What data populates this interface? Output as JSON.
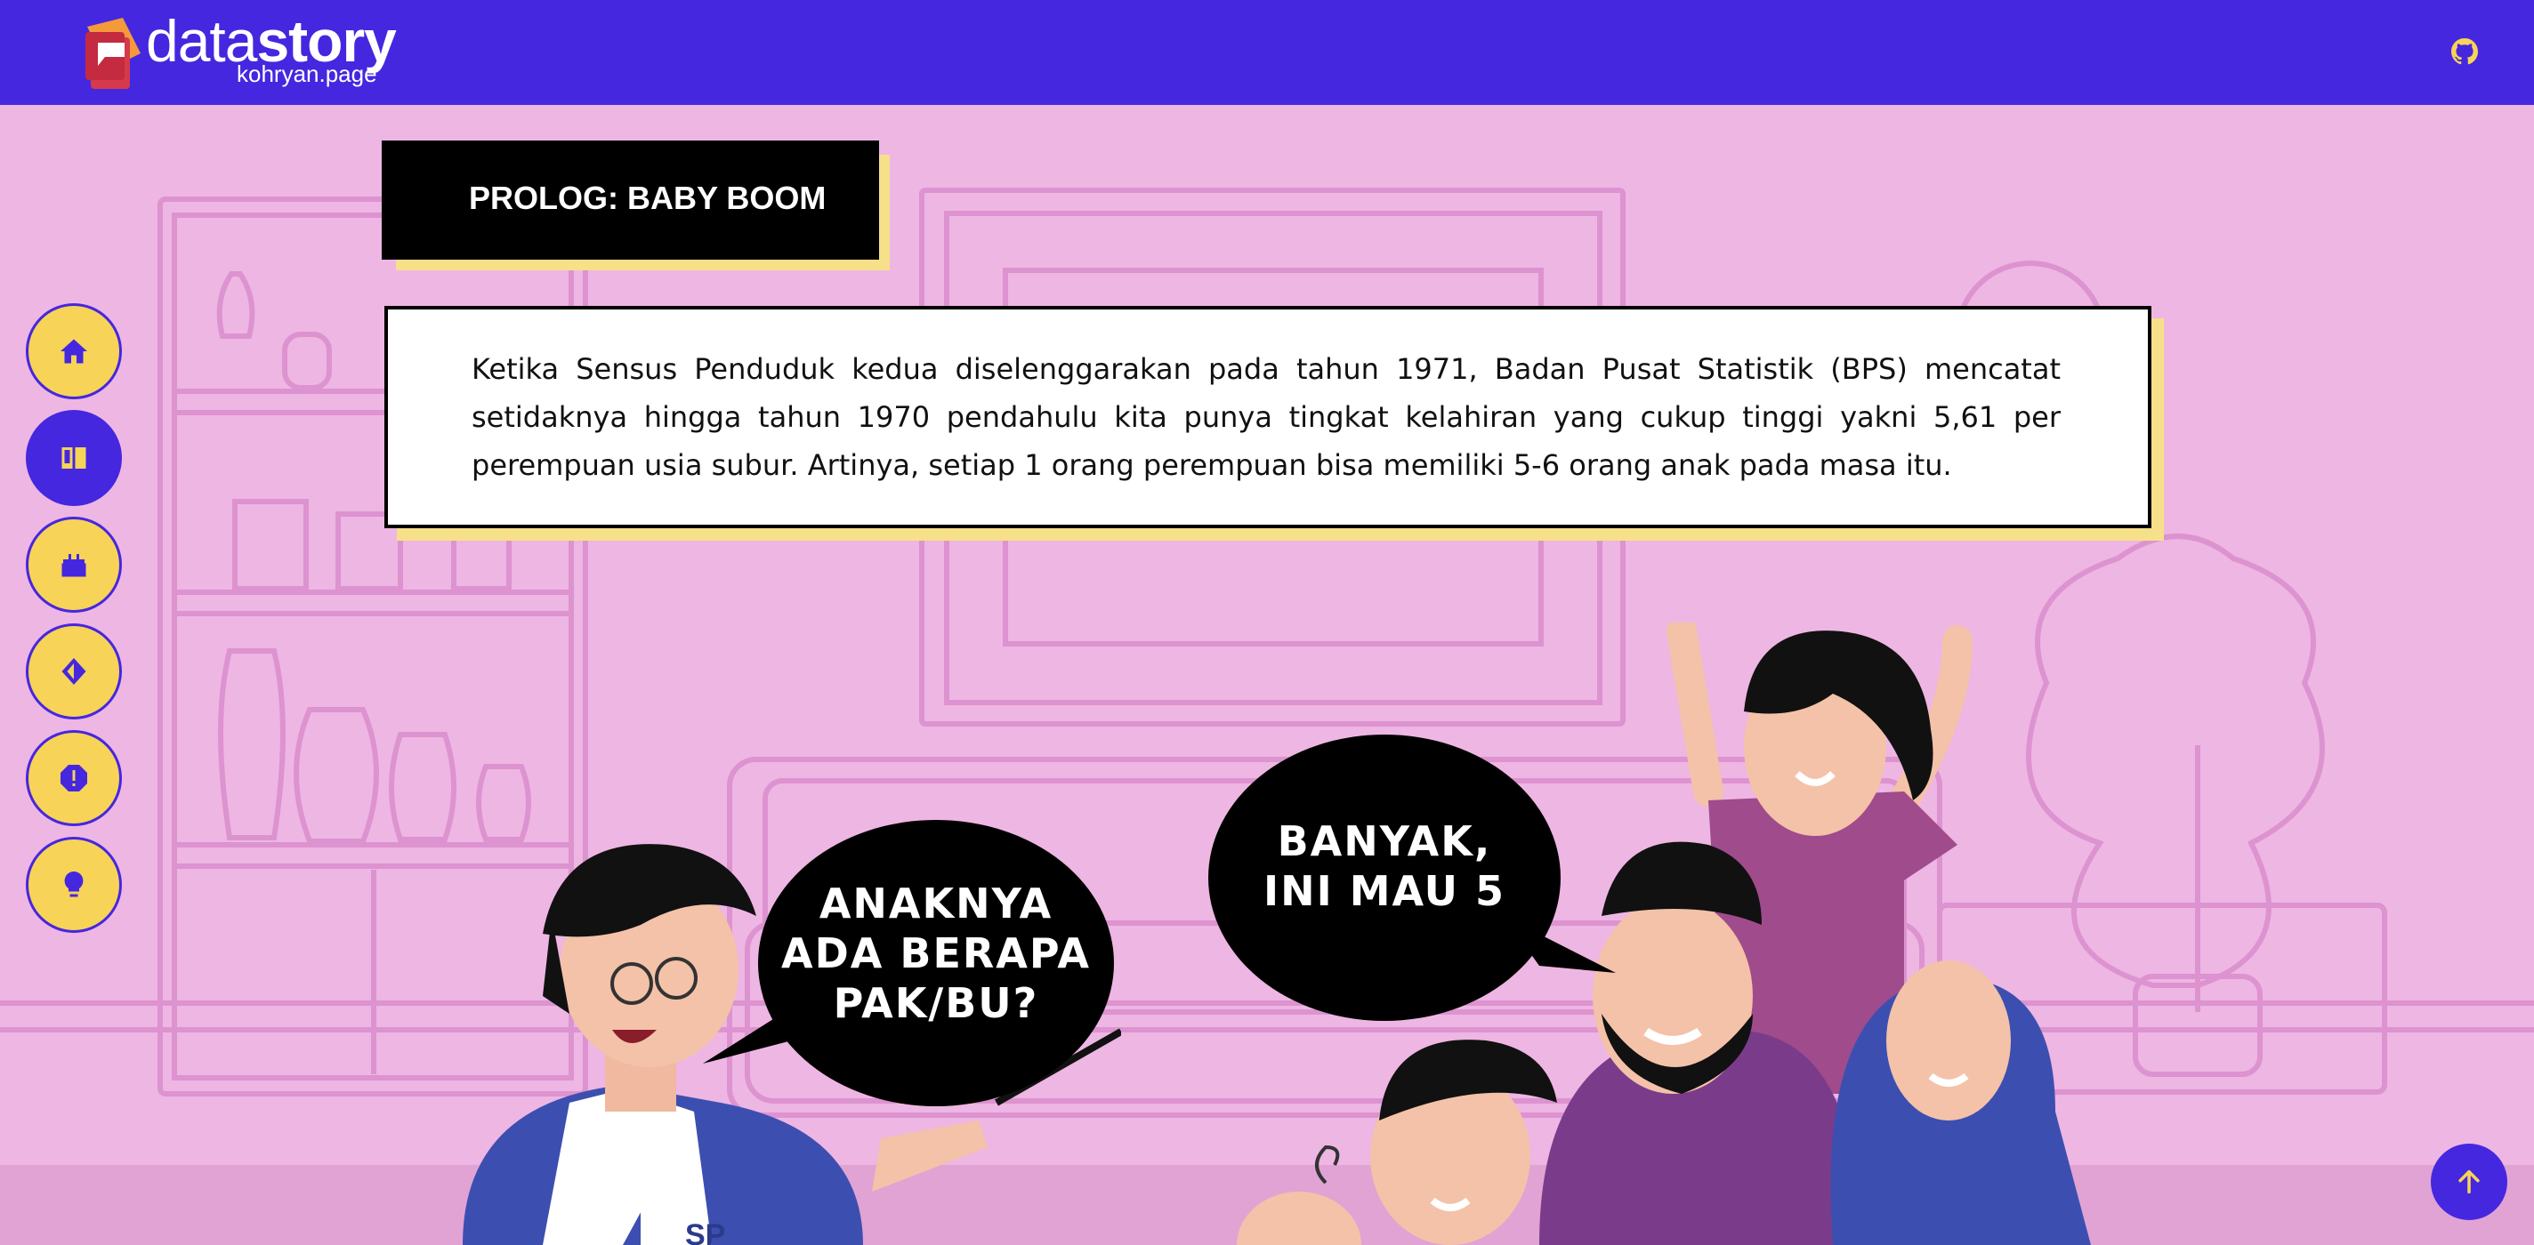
{
  "header": {
    "brand_light": "data",
    "brand_bold": "story",
    "brand_sub": "kohryan.page",
    "github_icon": "github-icon"
  },
  "nav": {
    "items": [
      {
        "icon": "home-icon",
        "active": false
      },
      {
        "icon": "book-icon",
        "active": true
      },
      {
        "icon": "cake-icon",
        "active": false
      },
      {
        "icon": "compass-icon",
        "active": false
      },
      {
        "icon": "alert-icon",
        "active": false
      },
      {
        "icon": "lightbulb-icon",
        "active": false
      }
    ]
  },
  "chapter": {
    "title": "PROLOG: BABY BOOM"
  },
  "story": {
    "text": "Ketika Sensus Penduduk kedua diselenggarakan pada tahun 1971, Badan Pusat Statistik (BPS) mencatat setidaknya hingga tahun 1970 pendahulu kita punya tingkat kelahiran yang cukup tinggi yakni 5,61 per perempuan usia subur. Artinya, setiap 1 orang perempuan bisa memiliki 5-6 orang anak pada masa itu."
  },
  "illustration": {
    "bubble_left": "ANAKNYA\nADA BERAPA\nPAK/BU?",
    "bubble_right": "BANYAK,\nINI MAU 5",
    "shirt_label": "SP"
  },
  "colors": {
    "primary": "#4527df",
    "accent": "#f7d358",
    "background": "#eeb6e3",
    "shadow": "#f7e08a"
  }
}
